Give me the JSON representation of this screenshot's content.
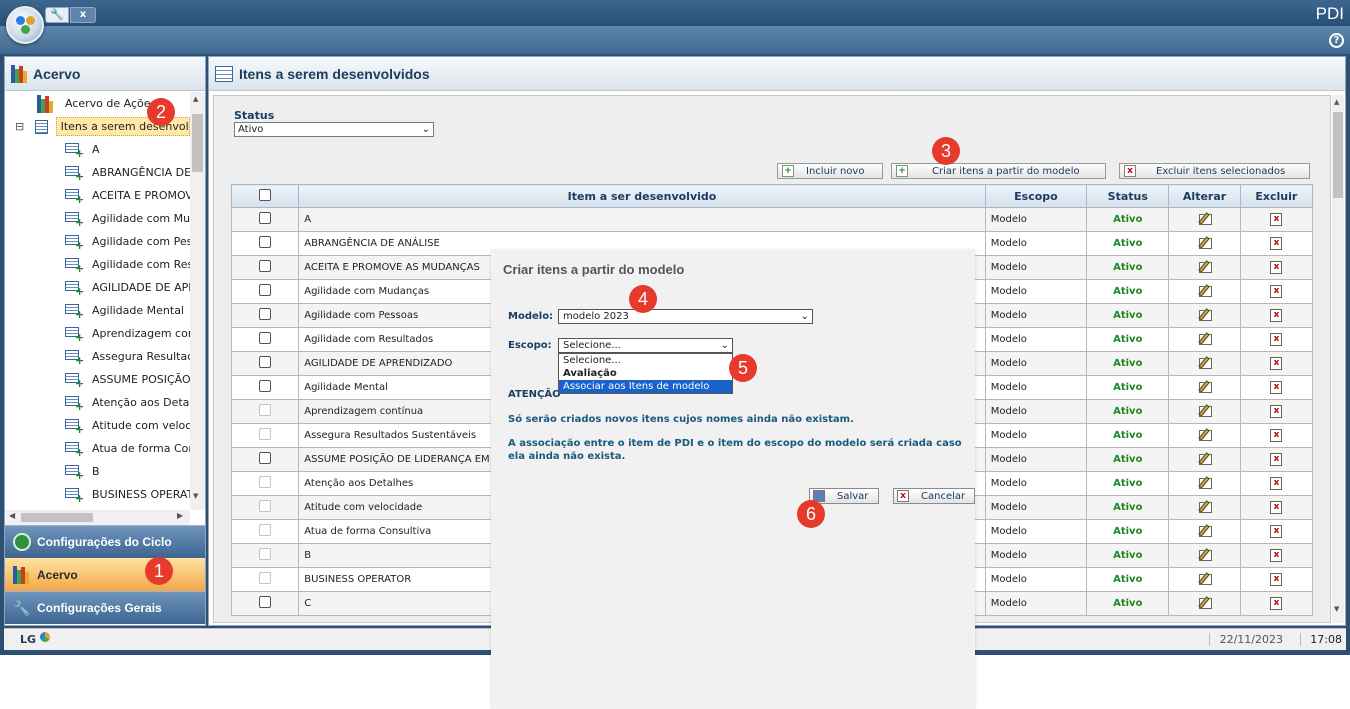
{
  "app": {
    "title": "PDI",
    "tab_tools_icon": "wrench-icon",
    "tab_close": "x",
    "help": "?"
  },
  "sidebar": {
    "title": "Acervo",
    "tree": [
      {
        "label": "Acervo de Ações",
        "icon": "books-icon",
        "expander": ""
      },
      {
        "label": "Itens a serem desenvolvidos",
        "icon": "list-icon",
        "expander": "⊟",
        "selected": true
      },
      {
        "label": "A"
      },
      {
        "label": "ABRANGÊNCIA DE ANÁLISE"
      },
      {
        "label": "ACEITA E PROMOVE AS MUDANÇAS"
      },
      {
        "label": "Agilidade com Mudanças"
      },
      {
        "label": "Agilidade com Pessoas"
      },
      {
        "label": "Agilidade com Resultados"
      },
      {
        "label": "AGILIDADE DE APRENDIZADO"
      },
      {
        "label": "Agilidade Mental"
      },
      {
        "label": "Aprendizagem contínua"
      },
      {
        "label": "Assegura Resultados Sustentáveis"
      },
      {
        "label": "ASSUME POSIÇÃO DE LIDERANÇA EM"
      },
      {
        "label": "Atenção aos Detalhes"
      },
      {
        "label": "Atitude com velocidade"
      },
      {
        "label": "Atua de forma Consultiva"
      },
      {
        "label": "B"
      },
      {
        "label": "BUSINESS OPERATOR"
      }
    ],
    "nav": [
      {
        "label": "Configurações do Ciclo",
        "icon": "cycle-icon"
      },
      {
        "label": "Acervo",
        "icon": "books-icon",
        "active": true
      },
      {
        "label": "Configurações Gerais",
        "icon": "wrench-icon"
      }
    ]
  },
  "main": {
    "title": "Itens a serem desenvolvidos",
    "status_label": "Status",
    "status_value": "Ativo",
    "buttons": {
      "incluir": "Incluir novo",
      "criar": "Criar itens a partir do modelo",
      "excluir": "Excluir itens selecionados"
    },
    "columns": [
      "",
      "Item a ser desenvolvido",
      "Escopo",
      "Status",
      "Alterar",
      "Excluir"
    ],
    "rows": [
      {
        "item": "A",
        "escopo": "Modelo",
        "status": "Ativo",
        "enabled": true
      },
      {
        "item": "ABRANGÊNCIA DE ANÁLISE",
        "escopo": "Modelo",
        "status": "Ativo",
        "enabled": true
      },
      {
        "item": "ACEITA E PROMOVE AS MUDANÇAS",
        "escopo": "Modelo",
        "status": "Ativo",
        "enabled": true
      },
      {
        "item": "Agilidade com Mudanças",
        "escopo": "Modelo",
        "status": "Ativo",
        "enabled": true
      },
      {
        "item": "Agilidade com Pessoas",
        "escopo": "Modelo",
        "status": "Ativo",
        "enabled": true
      },
      {
        "item": "Agilidade com Resultados",
        "escopo": "Modelo",
        "status": "Ativo",
        "enabled": true
      },
      {
        "item": "AGILIDADE DE APRENDIZADO",
        "escopo": "Modelo",
        "status": "Ativo",
        "enabled": true
      },
      {
        "item": "Agilidade Mental",
        "escopo": "Modelo",
        "status": "Ativo",
        "enabled": true
      },
      {
        "item": "Aprendizagem contínua",
        "escopo": "Modelo",
        "status": "Ativo",
        "enabled": false
      },
      {
        "item": "Assegura Resultados Sustentáveis",
        "escopo": "Modelo",
        "status": "Ativo",
        "enabled": false
      },
      {
        "item": "ASSUME POSIÇÃO DE LIDERANÇA EM",
        "escopo": "Modelo",
        "status": "Ativo",
        "enabled": true
      },
      {
        "item": "Atenção aos Detalhes",
        "escopo": "Modelo",
        "status": "Ativo",
        "enabled": false
      },
      {
        "item": "Atitude com velocidade",
        "escopo": "Modelo",
        "status": "Ativo",
        "enabled": false
      },
      {
        "item": "Atua de forma Consultiva",
        "escopo": "Modelo",
        "status": "Ativo",
        "enabled": false
      },
      {
        "item": "B",
        "escopo": "Modelo",
        "status": "Ativo",
        "enabled": false
      },
      {
        "item": "BUSINESS OPERATOR",
        "escopo": "Modelo",
        "status": "Ativo",
        "enabled": false
      },
      {
        "item": "C",
        "escopo": "Modelo",
        "status": "Ativo",
        "enabled": true
      }
    ]
  },
  "modal": {
    "title": "Criar itens a partir do modelo",
    "modelo_label": "Modelo:",
    "modelo_value": "modelo 2023",
    "escopo_label": "Escopo:",
    "escopo_value": "Selecione...",
    "options": [
      "Selecione...",
      "Avaliação",
      "Associar aos Itens de modelo"
    ],
    "atencao": "ATENÇÃO",
    "note1": "Só serão criados novos itens cujos nomes ainda não existam.",
    "note2": "A associação entre o item de PDI e o item do escopo do modelo será criada caso ela ainda não exista.",
    "salvar": "Salvar",
    "cancelar": "Cancelar"
  },
  "steps": [
    "1",
    "2",
    "3",
    "4",
    "5",
    "6"
  ],
  "footer": {
    "logo": "LG",
    "date": "22/11/2023",
    "time": "17:08"
  }
}
